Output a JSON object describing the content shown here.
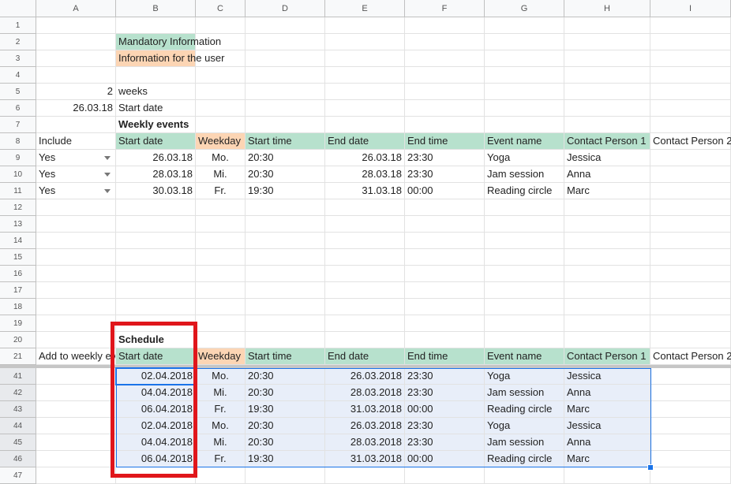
{
  "columns": [
    "A",
    "B",
    "C",
    "D",
    "E",
    "F",
    "G",
    "H",
    "I"
  ],
  "rows": {
    "r1": "1",
    "r2": "2",
    "r3": "3",
    "r4": "4",
    "r5": "5",
    "r6": "6",
    "r7": "7",
    "r8": "8",
    "r9": "9",
    "r10": "10",
    "r11": "11",
    "r12": "12",
    "r13": "13",
    "r14": "14",
    "r15": "15",
    "r16": "16",
    "r17": "17",
    "r18": "18",
    "r19": "19",
    "r20": "20",
    "r21": "21",
    "r41": "41",
    "r42": "42",
    "r43": "43",
    "r44": "44",
    "r45": "45",
    "r46": "46",
    "r47": "47"
  },
  "legend": {
    "mandatory": "Mandatory Information",
    "user_info": "Information for the user"
  },
  "settings": {
    "weeks_value": "2",
    "weeks_label": "weeks",
    "start_date_value": "26.03.18",
    "start_date_label": "Start date"
  },
  "weekly": {
    "title": "Weekly events",
    "headers": [
      "Include",
      "Start date",
      "Weekday",
      "Start time",
      "End date",
      "End time",
      "Event name",
      "Contact Person 1",
      "Contact Person 2"
    ],
    "rows": [
      [
        "Yes",
        "26.03.18",
        "Mo.",
        "20:30",
        "26.03.18",
        "23:30",
        "Yoga",
        "Jessica"
      ],
      [
        "Yes",
        "28.03.18",
        "Mi.",
        "20:30",
        "28.03.18",
        "23:30",
        "Jam session",
        "Anna"
      ],
      [
        "Yes",
        "30.03.18",
        "Fr.",
        "19:30",
        "31.03.18",
        "00:00",
        "Reading circle",
        "Marc"
      ]
    ]
  },
  "schedule": {
    "title": "Schedule",
    "headers": [
      "Add to weekly events",
      "Start date",
      "Weekday",
      "Start time",
      "End date",
      "End time",
      "Event name",
      "Contact Person 1",
      "Contact Person 2"
    ],
    "rows": [
      [
        "02.04.2018",
        "Mo.",
        "20:30",
        "26.03.2018",
        "23:30",
        "Yoga",
        "Jessica"
      ],
      [
        "04.04.2018",
        "Mi.",
        "20:30",
        "28.03.2018",
        "23:30",
        "Jam session",
        "Anna"
      ],
      [
        "06.04.2018",
        "Fr.",
        "19:30",
        "31.03.2018",
        "00:00",
        "Reading circle",
        "Marc"
      ],
      [
        "02.04.2018",
        "Mo.",
        "20:30",
        "26.03.2018",
        "23:30",
        "Yoga",
        "Jessica"
      ],
      [
        "04.04.2018",
        "Mi.",
        "20:30",
        "28.03.2018",
        "23:30",
        "Jam session",
        "Anna"
      ],
      [
        "06.04.2018",
        "Fr.",
        "19:30",
        "31.03.2018",
        "00:00",
        "Reading circle",
        "Marc"
      ]
    ]
  },
  "colors": {
    "mandatory": "#b7e1cd",
    "user_info": "#fcd5b4",
    "selection": "#1a73e8",
    "highlight_box": "#e0161b"
  }
}
